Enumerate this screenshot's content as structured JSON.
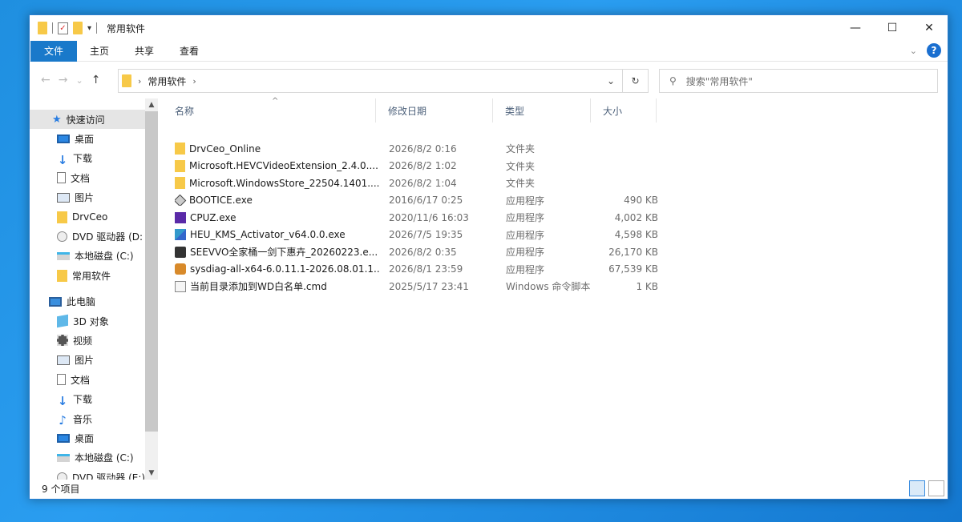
{
  "window": {
    "title": "常用软件",
    "controls": {
      "minimize": "—",
      "maximize": "☐",
      "close": "✕"
    }
  },
  "ribbon": {
    "tabs": [
      "文件",
      "主页",
      "共享",
      "查看"
    ]
  },
  "navigation": {
    "back": "←",
    "forward": "→",
    "recent": "⌄",
    "up": "↑",
    "breadcrumb": [
      "常用软件"
    ],
    "search_placeholder": "搜索\"常用软件\""
  },
  "nav_pane": {
    "quick_access": "快速访问",
    "quick_items": [
      {
        "label": "桌面",
        "icon": "desktop-icon",
        "pinned": true
      },
      {
        "label": "下载",
        "icon": "download-icon",
        "pinned": true
      },
      {
        "label": "文档",
        "icon": "document-icon",
        "pinned": true
      },
      {
        "label": "图片",
        "icon": "picture-icon",
        "pinned": true
      },
      {
        "label": "DrvCeo",
        "icon": "folder-icon",
        "pinned": false
      },
      {
        "label": "DVD 驱动器 (D:",
        "icon": "dvd-icon",
        "pinned": false
      },
      {
        "label": "本地磁盘 (C:)",
        "icon": "disk-icon",
        "pinned": false
      },
      {
        "label": "常用软件",
        "icon": "folder-icon",
        "pinned": false
      }
    ],
    "this_pc": "此电脑",
    "pc_items": [
      {
        "label": "3D 对象",
        "icon": "3d-objects-icon"
      },
      {
        "label": "视频",
        "icon": "video-icon"
      },
      {
        "label": "图片",
        "icon": "picture-icon"
      },
      {
        "label": "文档",
        "icon": "document-icon"
      },
      {
        "label": "下载",
        "icon": "download-icon"
      },
      {
        "label": "音乐",
        "icon": "music-icon"
      },
      {
        "label": "桌面",
        "icon": "desktop-icon"
      },
      {
        "label": "本地磁盘 (C:)",
        "icon": "disk-icon"
      },
      {
        "label": "DVD 驱动器 (E:)",
        "icon": "dvd-icon"
      }
    ]
  },
  "file_list": {
    "columns": [
      "名称",
      "修改日期",
      "类型",
      "大小"
    ],
    "rows": [
      {
        "name": "DrvCeo_Online",
        "date": "2026/8/2 0:16",
        "type": "文件夹",
        "size": "",
        "icon": "folder-icon"
      },
      {
        "name": "Microsoft.HEVCVideoExtension_2.4.0....",
        "date": "2026/8/2 1:02",
        "type": "文件夹",
        "size": "",
        "icon": "folder-icon"
      },
      {
        "name": "Microsoft.WindowsStore_22504.1401....",
        "date": "2026/8/2 1:04",
        "type": "文件夹",
        "size": "",
        "icon": "folder-icon"
      },
      {
        "name": "BOOTICE.exe",
        "date": "2016/6/17 0:25",
        "type": "应用程序",
        "size": "490 KB",
        "icon": "bootice-icon"
      },
      {
        "name": "CPUZ.exe",
        "date": "2020/11/6 16:03",
        "type": "应用程序",
        "size": "4,002 KB",
        "icon": "cpuz-icon"
      },
      {
        "name": "HEU_KMS_Activator_v64.0.0.exe",
        "date": "2026/7/5 19:35",
        "type": "应用程序",
        "size": "4,598 KB",
        "icon": "heu-kms-icon"
      },
      {
        "name": "SEEVVO全家桶一剑下惠卉_20260223.e...",
        "date": "2026/8/2 0:35",
        "type": "应用程序",
        "size": "26,170 KB",
        "icon": "seevvo-icon"
      },
      {
        "name": "sysdiag-all-x64-6.0.11.1-2026.08.01.1...",
        "date": "2026/8/1 23:59",
        "type": "应用程序",
        "size": "67,539 KB",
        "icon": "sysdiag-icon"
      },
      {
        "name": "当前目录添加到WD白名单.cmd",
        "date": "2025/5/17 23:41",
        "type": "Windows 命令脚本",
        "size": "1 KB",
        "icon": "cmd-script-icon"
      }
    ]
  },
  "status": {
    "item_count": "9 个项目"
  }
}
